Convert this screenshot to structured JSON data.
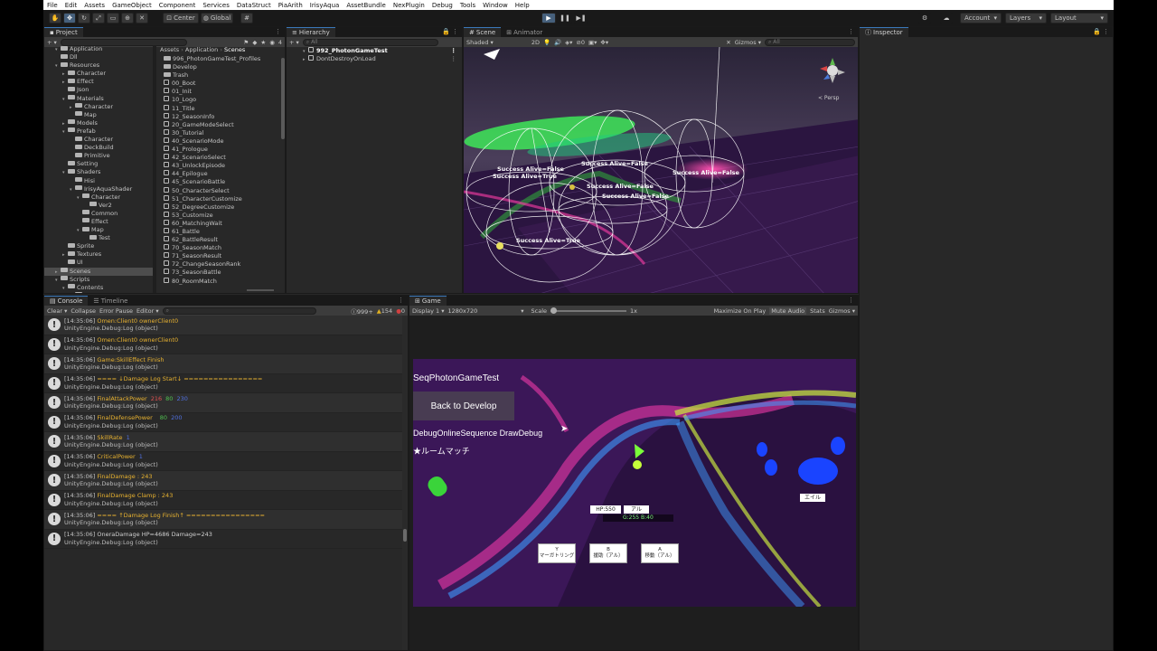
{
  "menu": [
    "File",
    "Edit",
    "Assets",
    "GameObject",
    "Component",
    "Services",
    "DataStruct",
    "PiaArith",
    "IrisyAqua",
    "AssetBundle",
    "NexPlugin",
    "Debug",
    "Tools",
    "Window",
    "Help"
  ],
  "toolbar": {
    "pivot": "Center",
    "space": "Global",
    "account": "Account",
    "layers": "Layers",
    "layout": "Layout"
  },
  "project": {
    "tab": "Project",
    "count": "4",
    "tree": [
      {
        "label": "Application",
        "depth": 2,
        "arrow": "▾"
      },
      {
        "label": "Dll",
        "depth": 2,
        "arrow": ""
      },
      {
        "label": "Resources",
        "depth": 2,
        "arrow": "▾"
      },
      {
        "label": "Character",
        "depth": 3,
        "arrow": "▸"
      },
      {
        "label": "Effect",
        "depth": 3,
        "arrow": "▸"
      },
      {
        "label": "Json",
        "depth": 3,
        "arrow": ""
      },
      {
        "label": "Materials",
        "depth": 3,
        "arrow": "▾"
      },
      {
        "label": "Character",
        "depth": 4,
        "arrow": "▸"
      },
      {
        "label": "Map",
        "depth": 4,
        "arrow": ""
      },
      {
        "label": "Models",
        "depth": 3,
        "arrow": "▸"
      },
      {
        "label": "Prefab",
        "depth": 3,
        "arrow": "▾"
      },
      {
        "label": "Character",
        "depth": 4,
        "arrow": ""
      },
      {
        "label": "DeckBuild",
        "depth": 4,
        "arrow": ""
      },
      {
        "label": "Primitive",
        "depth": 4,
        "arrow": ""
      },
      {
        "label": "Setting",
        "depth": 3,
        "arrow": ""
      },
      {
        "label": "Shaders",
        "depth": 3,
        "arrow": "▾"
      },
      {
        "label": "Hisi",
        "depth": 4,
        "arrow": ""
      },
      {
        "label": "IrisyAquaShader",
        "depth": 4,
        "arrow": "▾"
      },
      {
        "label": "Character",
        "depth": 5,
        "arrow": "▾"
      },
      {
        "label": "Ver2",
        "depth": 6,
        "arrow": ""
      },
      {
        "label": "Common",
        "depth": 5,
        "arrow": ""
      },
      {
        "label": "Effect",
        "depth": 5,
        "arrow": ""
      },
      {
        "label": "Map",
        "depth": 5,
        "arrow": "▾"
      },
      {
        "label": "Test",
        "depth": 6,
        "arrow": ""
      },
      {
        "label": "Sprite",
        "depth": 3,
        "arrow": ""
      },
      {
        "label": "Textures",
        "depth": 3,
        "arrow": "▸"
      },
      {
        "label": "UI",
        "depth": 3,
        "arrow": ""
      },
      {
        "label": "Scenes",
        "depth": 2,
        "arrow": "▸",
        "selected": true
      },
      {
        "label": "Scripts",
        "depth": 2,
        "arrow": "▾"
      },
      {
        "label": "Contents",
        "depth": 3,
        "arrow": "▾"
      },
      {
        "label": "Core",
        "depth": 4,
        "arrow": ""
      }
    ],
    "breadcrumb": [
      "Assets",
      "Application",
      "Scenes"
    ],
    "files": [
      {
        "label": "996_PhotonGameTest_Profiles",
        "folder": true
      },
      {
        "label": "Develop",
        "folder": true
      },
      {
        "label": "Trash",
        "folder": true
      },
      {
        "label": "00_Boot"
      },
      {
        "label": "01_Init"
      },
      {
        "label": "10_Logo"
      },
      {
        "label": "11_Title"
      },
      {
        "label": "12_SeasonInfo"
      },
      {
        "label": "20_GameModeSelect"
      },
      {
        "label": "30_Tutorial"
      },
      {
        "label": "40_ScenarioMode"
      },
      {
        "label": "41_Prologue"
      },
      {
        "label": "42_ScenarioSelect"
      },
      {
        "label": "43_UnlockEpisode"
      },
      {
        "label": "44_Epilogue"
      },
      {
        "label": "45_ScenarioBattle"
      },
      {
        "label": "50_CharacterSelect"
      },
      {
        "label": "51_CharacterCustomize"
      },
      {
        "label": "52_DegreeCustomize"
      },
      {
        "label": "53_Customize"
      },
      {
        "label": "60_MatchingWait"
      },
      {
        "label": "61_Battle"
      },
      {
        "label": "62_BattleResult"
      },
      {
        "label": "70_SeasonMatch"
      },
      {
        "label": "71_SeasonResult"
      },
      {
        "label": "72_ChangeSeasonRank"
      },
      {
        "label": "73_SeasonBattle"
      },
      {
        "label": "80_RoomMatch"
      }
    ]
  },
  "hierarchy": {
    "tab": "Hierarchy",
    "search": "All",
    "items": [
      "992_PhotonGameTest",
      "DontDestroyOnLoad"
    ]
  },
  "scene": {
    "tab": "Scene",
    "tab2": "Animator",
    "shading": "Shaded",
    "mode2d": "2D",
    "gizmos": "Gizmos",
    "search": "All",
    "persp": "< Persp",
    "labels": [
      "Success Alive=False",
      "Success Alive=True",
      "Success Alive=False",
      "Success Alive=False",
      "Success Alive=False",
      "Success Alive=False",
      "Success Alive=True"
    ]
  },
  "console": {
    "tab": "Console",
    "tab2": "Timeline",
    "clear": "Clear",
    "collapse": "Collapse",
    "error_pause": "Error Pause",
    "editor": "Editor",
    "count_log": "999+",
    "count_warn": "154",
    "count_err": "0",
    "logs": [
      {
        "time": "[14:35:06]",
        "msg": "Omen:Client0  ownerClient0",
        "sub": "UnityEngine.Debug:Log (object)"
      },
      {
        "time": "[14:35:06]",
        "msg": "Omen:Client0  ownerClient0",
        "sub": "UnityEngine.Debug:Log (object)"
      },
      {
        "time": "[14:35:06]",
        "msg": "Game:SkillEffect Finish",
        "sub": "UnityEngine.Debug:Log (object)"
      },
      {
        "time": "[14:35:06]",
        "msg": "==== ↓Damage Log Start↓ ================",
        "sub": "UnityEngine.Debug:Log (object)"
      },
      {
        "time": "[14:35:06]",
        "msg": "FinalAttackPower",
        "extra": [
          [
            "216",
            "#e05050"
          ],
          [
            "80",
            "#50c050"
          ],
          [
            "230",
            "#5070e0"
          ]
        ],
        "sub": "UnityEngine.Debug:Log (object)"
      },
      {
        "time": "[14:35:06]",
        "msg": "FinalDefensePower",
        "extra": [
          [
            "",
            "#e05050"
          ],
          [
            "80",
            "#50c050"
          ],
          [
            "200",
            "#5070e0"
          ]
        ],
        "sub": "UnityEngine.Debug:Log (object)"
      },
      {
        "time": "[14:35:06]",
        "msg": "SkillRate",
        "extra": [
          [
            "1",
            "#5070e0"
          ]
        ],
        "sub": "UnityEngine.Debug:Log (object)"
      },
      {
        "time": "[14:35:06]",
        "msg": "CriticalPower",
        "extra": [
          [
            "1",
            "#5070e0"
          ]
        ],
        "sub": "UnityEngine.Debug:Log (object)"
      },
      {
        "time": "[14:35:06]",
        "msg": "FinalDamage : 243",
        "sub": "UnityEngine.Debug:Log (object)"
      },
      {
        "time": "[14:35:06]",
        "msg": "FinalDamage Clamp : 243",
        "sub": "UnityEngine.Debug:Log (object)"
      },
      {
        "time": "[14:35:06]",
        "msg": "==== ↑Damage Log Finish↑ ================",
        "sub": "UnityEngine.Debug:Log (object)"
      },
      {
        "time": "[14:35:06]",
        "msg": "OneraDamage HP=4686 Damage=243",
        "sub": "UnityEngine.Debug:Log (object)",
        "white": true
      }
    ]
  },
  "game": {
    "tab": "Game",
    "display": "Display 1",
    "resolution": "1280x720",
    "scale": "Scale",
    "scale_val": "1x",
    "maximize": "Maximize On Play",
    "mute": "Mute Audio",
    "stats": "Stats",
    "gizmos": "Gizmos",
    "title": "SeqPhotonGameTest",
    "back": "Back to Develop",
    "debug_text": "DebugOnlineSequence DrawDebug",
    "room": "★ルームマッチ",
    "hp": "HP:550",
    "name": "アル",
    "resources": "G:255  B:40",
    "enemy": "エイル",
    "buttons": [
      {
        "key": "Y",
        "label": "マーガトリング"
      },
      {
        "key": "B",
        "label": "援助（アル）"
      },
      {
        "key": "A",
        "label": "移動（アル）"
      }
    ]
  },
  "inspector": {
    "tab": "Inspector"
  }
}
